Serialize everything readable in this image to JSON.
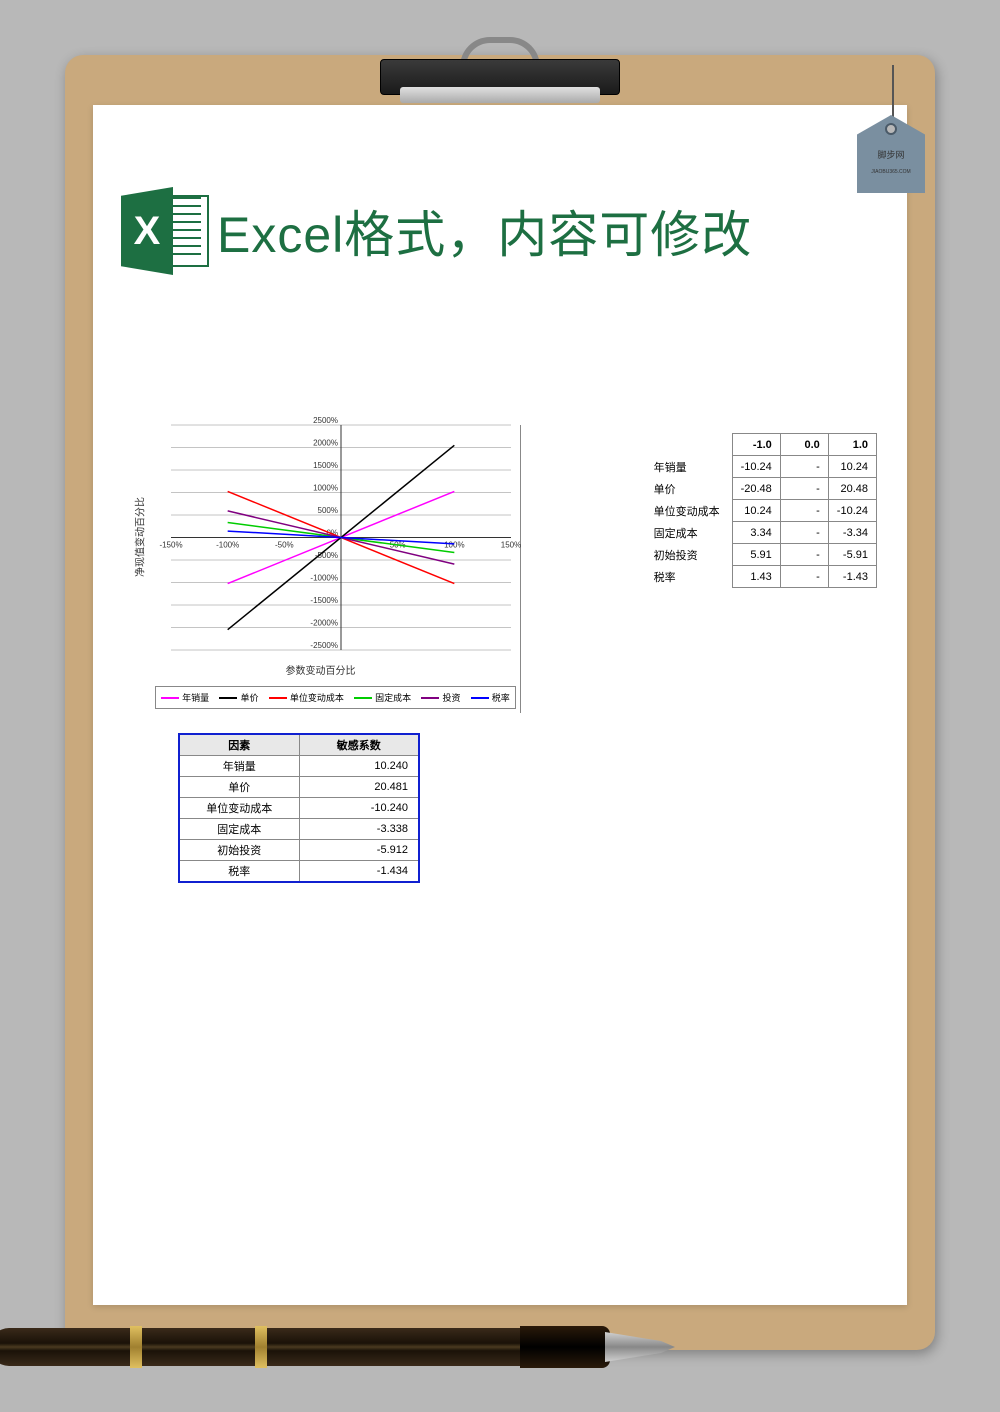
{
  "header": {
    "icon_letter": "X",
    "title": "Excel格式，内容可修改"
  },
  "tag": {
    "line1": "脚步网",
    "line2": "JIAOBU365.COM"
  },
  "chart_data": {
    "type": "line",
    "xlabel": "参数变动百分比",
    "ylabel": "净现值变动百分比",
    "x_ticks": [
      "-150%",
      "-100%",
      "-50%",
      "0%",
      "50%",
      "100%",
      "150%"
    ],
    "y_ticks": [
      "-2500%",
      "-2000%",
      "-1500%",
      "-1000%",
      "-500%",
      "0%",
      "500%",
      "1000%",
      "1500%",
      "2000%",
      "2500%"
    ],
    "xlim": [
      -150,
      150
    ],
    "ylim": [
      -2500,
      2500
    ],
    "series": [
      {
        "name": "年销量",
        "color": "#ff00ff",
        "slope": 10.24,
        "points_pct": [
          [
            -100,
            -1024
          ],
          [
            100,
            1024
          ]
        ]
      },
      {
        "name": "单价",
        "color": "#000000",
        "slope": 20.48,
        "points_pct": [
          [
            -100,
            -2048
          ],
          [
            100,
            2048
          ]
        ]
      },
      {
        "name": "单位变动成本",
        "color": "#ff0000",
        "slope": -10.24,
        "points_pct": [
          [
            -100,
            1024
          ],
          [
            100,
            -1024
          ]
        ]
      },
      {
        "name": "固定成本",
        "color": "#00cc00",
        "slope": -3.34,
        "points_pct": [
          [
            -100,
            334
          ],
          [
            100,
            -334
          ]
        ]
      },
      {
        "name": "投资",
        "color": "#800080",
        "slope": -5.91,
        "points_pct": [
          [
            -100,
            591
          ],
          [
            100,
            -591
          ]
        ]
      },
      {
        "name": "税率",
        "color": "#0000ff",
        "slope": -1.43,
        "points_pct": [
          [
            -100,
            143
          ],
          [
            100,
            -143
          ]
        ]
      }
    ]
  },
  "data_table": {
    "headers": [
      "-1.0",
      "0.0",
      "1.0"
    ],
    "rows": [
      {
        "label": "年销量",
        "vals": [
          "-10.24",
          "-",
          "10.24"
        ]
      },
      {
        "label": "单价",
        "vals": [
          "-20.48",
          "-",
          "20.48"
        ]
      },
      {
        "label": "单位变动成本",
        "vals": [
          "10.24",
          "-",
          "-10.24"
        ]
      },
      {
        "label": "固定成本",
        "vals": [
          "3.34",
          "-",
          "-3.34"
        ]
      },
      {
        "label": "初始投资",
        "vals": [
          "5.91",
          "-",
          "-5.91"
        ]
      },
      {
        "label": "税率",
        "vals": [
          "1.43",
          "-",
          "-1.43"
        ]
      }
    ]
  },
  "sensitivity_table": {
    "headers": [
      "因素",
      "敏感系数"
    ],
    "rows": [
      {
        "name": "年销量",
        "val": "10.240"
      },
      {
        "name": "单价",
        "val": "20.481"
      },
      {
        "name": "单位变动成本",
        "val": "-10.240"
      },
      {
        "name": "固定成本",
        "val": "-3.338"
      },
      {
        "name": "初始投资",
        "val": "-5.912"
      },
      {
        "name": "税率",
        "val": "-1.434"
      }
    ]
  }
}
